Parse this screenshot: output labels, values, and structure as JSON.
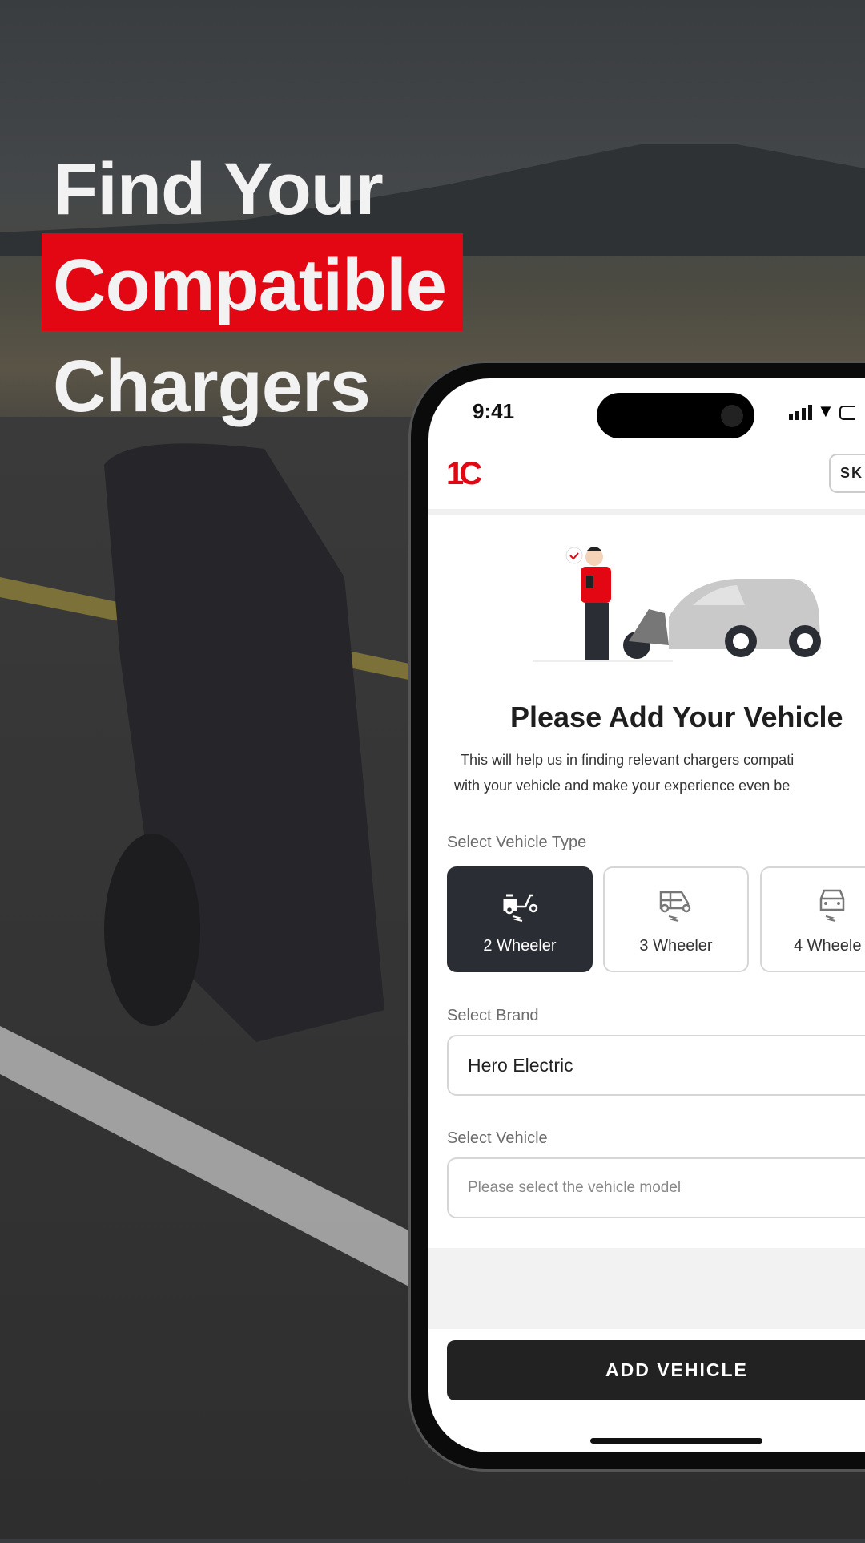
{
  "headline": {
    "line1": "Find Your",
    "line2": "Compatible",
    "line3": "Chargers",
    "highlight_color": "#e30613"
  },
  "status_bar": {
    "time": "9:41",
    "icons": [
      "signal-icon",
      "wifi-icon",
      "battery-icon"
    ]
  },
  "header": {
    "logo": "1C",
    "skip_label": "SK"
  },
  "main": {
    "title": "Please Add Your Vehicle",
    "subtitle_line1": "This will help us in finding relevant chargers compati",
    "subtitle_line2": "with your vehicle and make your experience even be",
    "vehicle_type_label": "Select Vehicle Type",
    "vehicle_types": [
      {
        "label": "2 Wheeler",
        "icon": "scooter-icon",
        "selected": true
      },
      {
        "label": "3 Wheeler",
        "icon": "rickshaw-icon",
        "selected": false
      },
      {
        "label": "4 Wheele",
        "icon": "car-icon",
        "selected": false
      }
    ],
    "brand_label": "Select Brand",
    "brand_value": "Hero Electric",
    "vehicle_label": "Select Vehicle",
    "vehicle_placeholder": "Please select the vehicle model"
  },
  "footer": {
    "add_button": "ADD VEHICLE"
  },
  "colors": {
    "accent": "#e30613",
    "dark": "#2a2d33"
  }
}
